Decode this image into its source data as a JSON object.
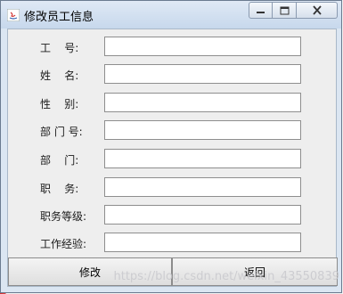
{
  "window": {
    "title": "修改员工信息",
    "controls": {
      "minimize_icon": "minimize-icon",
      "maximize_icon": "maximize-icon",
      "close_icon": "close-icon"
    }
  },
  "form": {
    "fields": [
      {
        "label": "工    号:",
        "value": ""
      },
      {
        "label": "姓    名:",
        "value": ""
      },
      {
        "label": "性    别:",
        "value": ""
      },
      {
        "label": "部 门 号:",
        "value": ""
      },
      {
        "label": "部    门:",
        "value": ""
      },
      {
        "label": "职    务:",
        "value": ""
      },
      {
        "label": "职务等级:",
        "value": ""
      },
      {
        "label": "工作经验:",
        "value": ""
      }
    ]
  },
  "buttons": {
    "modify_label": "修改",
    "back_label": "返回"
  },
  "watermark": "https://blog.csdn.net/weixin_43550839",
  "colors": {
    "titlebar": "#c7d8ec",
    "content_bg": "#eeeeee",
    "desktop_accent": "#d02e2e"
  }
}
